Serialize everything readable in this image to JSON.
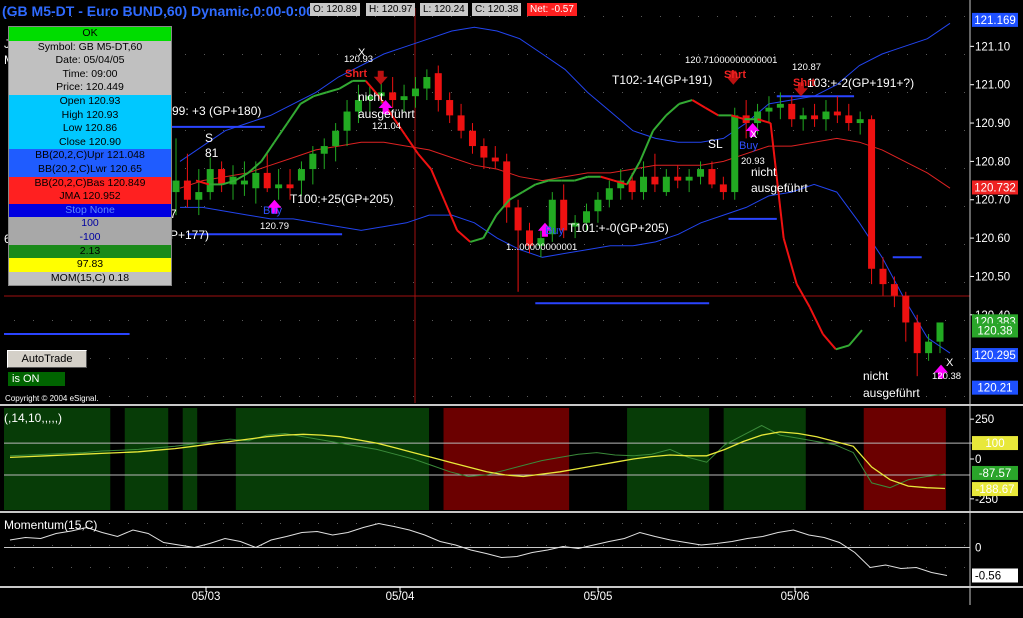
{
  "window": {
    "title": "(GB M5-DT - Euro BUND,60) Dynamic,0:00-0:00",
    "open_label": "O: 120.89",
    "high_label": "H: 120.97",
    "low_label": "L: 120.24",
    "close_label": "C: 120.38",
    "net_label": "Net: -0.57",
    "copyright": "Copyright © 2004 eSignal."
  },
  "colors": {
    "bull_candle": "#22aa22",
    "bear_candle": "#ee1111",
    "bb_band": "#2244ee",
    "bb_basis": "#dd2222",
    "jma_up": "#33aa33",
    "jma_down": "#ee1111",
    "osc_bull_zone": "#073c07",
    "osc_bear_zone": "#6b0000",
    "cci_line": "#e8e83a",
    "momentum_line": "#e0e0e0",
    "buy_arrow": "#ff00ff",
    "short_arrow": "#bb1111"
  },
  "data_window": {
    "header": "OK",
    "symbol": "Symbol: GB M5-DT,60",
    "date": "Date: 05/04/05",
    "time": "Time: 09:00",
    "price": "Price: 120.449",
    "open": "Open 120.93",
    "high": "High 120.93",
    "low": "Low 120.86",
    "close": "Close 120.90",
    "bb_upper": "BB(20,2,C)Upr 121.048",
    "bb_lower": "BB(20,2,C)Lwr 120.65",
    "bb_basis": "BB(20,2,C)Bas 120.849",
    "jma": "JMA 120.952",
    "stop": "Stop  None",
    "v1": "100",
    "v2": "-100",
    "v3": "2.13",
    "v4": "97.83",
    "momentum": "MOM(15,C)  0.18"
  },
  "controls": {
    "autotrade_label": "AutoTrade",
    "status_label": "is ON"
  },
  "panes": {
    "price": "",
    "oscillator": "(,14,10,,,,,)",
    "momentum": "Momentum(15,C)"
  },
  "annotations": {
    "t99": "99: +3 (GP+180)",
    "s": "S",
    "s81": "81",
    "sev": "7",
    "p177": "P+177)",
    "six": "6",
    "t100": "T100:+25(GP+205)",
    "t101": "T101:+-0(GP+205)",
    "t102": "T102:-14(GP+191)",
    "t103": "103:+-2(GP+191+?)",
    "sl": "SL",
    "shrt": "Shrt",
    "buy": "Buy",
    "x": "X",
    "nicht": "nicht",
    "ausgefuhrt": "ausgeführt",
    "p12093": "120.93",
    "p12104": "121.04",
    "p12079": "120.79",
    "p12071": "120.71000000000001",
    "p12087": "120.87",
    "p12093b": "20.93",
    "p12061": "1...00000000001",
    "p12038": "120.38",
    "j": "J",
    "m": "M"
  },
  "chart_data": [
    {
      "type": "candlestick",
      "title": "(GB M5-DT - Euro BUND,60) Dynamic,0:00-0:00",
      "x_tick_labels": [
        "05/03",
        "05/04",
        "05/05",
        "05/06"
      ],
      "y_ticks": [
        120.4,
        120.5,
        120.6,
        120.7,
        120.8,
        120.9,
        121.0,
        121.1
      ],
      "ylim": [
        120.17,
        121.2
      ],
      "price_markers": [
        {
          "label": "121.169",
          "value": 121.169,
          "color": "#1e50ff"
        },
        {
          "label": "120.732",
          "value": 120.732,
          "color": "#ee2222"
        },
        {
          "label": "120.383",
          "value": 120.383,
          "color": "#2aa52a"
        },
        {
          "label": "120.38",
          "value": 120.38,
          "color": "#2aa52a"
        },
        {
          "label": "120.295",
          "value": 120.295,
          "color": "#1e50ff"
        },
        {
          "label": "120.21",
          "value": 120.21,
          "color": "#1e50ff"
        }
      ],
      "candles": [
        {
          "o": 120.72,
          "h": 120.86,
          "l": 120.66,
          "c": 120.75
        },
        {
          "o": 120.75,
          "h": 120.82,
          "l": 120.68,
          "c": 120.7
        },
        {
          "o": 120.7,
          "h": 120.78,
          "l": 120.66,
          "c": 120.72
        },
        {
          "o": 120.72,
          "h": 120.81,
          "l": 120.7,
          "c": 120.78
        },
        {
          "o": 120.78,
          "h": 120.8,
          "l": 120.72,
          "c": 120.74
        },
        {
          "o": 120.74,
          "h": 120.79,
          "l": 120.7,
          "c": 120.76
        },
        {
          "o": 120.74,
          "h": 120.8,
          "l": 120.71,
          "c": 120.75
        },
        {
          "o": 120.73,
          "h": 120.8,
          "l": 120.69,
          "c": 120.77
        },
        {
          "o": 120.77,
          "h": 120.82,
          "l": 120.72,
          "c": 120.73
        },
        {
          "o": 120.73,
          "h": 120.78,
          "l": 120.7,
          "c": 120.74
        },
        {
          "o": 120.74,
          "h": 120.78,
          "l": 120.7,
          "c": 120.73
        },
        {
          "o": 120.75,
          "h": 120.8,
          "l": 120.71,
          "c": 120.78
        },
        {
          "o": 120.78,
          "h": 120.84,
          "l": 120.74,
          "c": 120.82
        },
        {
          "o": 120.82,
          "h": 120.86,
          "l": 120.78,
          "c": 120.84
        },
        {
          "o": 120.84,
          "h": 120.9,
          "l": 120.8,
          "c": 120.88
        },
        {
          "o": 120.88,
          "h": 120.96,
          "l": 120.84,
          "c": 120.93
        },
        {
          "o": 120.93,
          "h": 121.0,
          "l": 120.9,
          "c": 120.96
        },
        {
          "o": 120.96,
          "h": 121.0,
          "l": 120.93,
          "c": 120.97
        },
        {
          "o": 120.97,
          "h": 121.01,
          "l": 120.95,
          "c": 120.98
        },
        {
          "o": 120.98,
          "h": 121.02,
          "l": 120.94,
          "c": 120.96
        },
        {
          "o": 120.96,
          "h": 121.0,
          "l": 120.93,
          "c": 120.97
        },
        {
          "o": 120.97,
          "h": 121.02,
          "l": 120.94,
          "c": 120.99
        },
        {
          "o": 120.99,
          "h": 121.04,
          "l": 120.96,
          "c": 121.02
        },
        {
          "o": 121.03,
          "h": 121.05,
          "l": 120.93,
          "c": 120.96
        },
        {
          "o": 120.96,
          "h": 120.98,
          "l": 120.9,
          "c": 120.92
        },
        {
          "o": 120.92,
          "h": 120.95,
          "l": 120.86,
          "c": 120.88
        },
        {
          "o": 120.88,
          "h": 120.9,
          "l": 120.82,
          "c": 120.84
        },
        {
          "o": 120.84,
          "h": 120.86,
          "l": 120.78,
          "c": 120.81
        },
        {
          "o": 120.81,
          "h": 120.84,
          "l": 120.78,
          "c": 120.8
        },
        {
          "o": 120.8,
          "h": 120.82,
          "l": 120.64,
          "c": 120.68
        },
        {
          "o": 120.68,
          "h": 120.7,
          "l": 120.46,
          "c": 120.62
        },
        {
          "o": 120.62,
          "h": 120.64,
          "l": 120.56,
          "c": 120.58
        },
        {
          "o": 120.58,
          "h": 120.62,
          "l": 120.55,
          "c": 120.6
        },
        {
          "o": 120.61,
          "h": 120.72,
          "l": 120.59,
          "c": 120.7
        },
        {
          "o": 120.7,
          "h": 120.74,
          "l": 120.6,
          "c": 120.62
        },
        {
          "o": 120.63,
          "h": 120.66,
          "l": 120.6,
          "c": 120.64
        },
        {
          "o": 120.64,
          "h": 120.69,
          "l": 120.62,
          "c": 120.67
        },
        {
          "o": 120.67,
          "h": 120.72,
          "l": 120.64,
          "c": 120.7
        },
        {
          "o": 120.7,
          "h": 120.75,
          "l": 120.68,
          "c": 120.73
        },
        {
          "o": 120.73,
          "h": 120.78,
          "l": 120.7,
          "c": 120.75
        },
        {
          "o": 120.75,
          "h": 120.77,
          "l": 120.7,
          "c": 120.72
        },
        {
          "o": 120.72,
          "h": 120.8,
          "l": 120.7,
          "c": 120.76
        },
        {
          "o": 120.76,
          "h": 120.82,
          "l": 120.72,
          "c": 120.74
        },
        {
          "o": 120.72,
          "h": 120.78,
          "l": 120.71,
          "c": 120.76
        },
        {
          "o": 120.76,
          "h": 120.79,
          "l": 120.73,
          "c": 120.75
        },
        {
          "o": 120.75,
          "h": 120.78,
          "l": 120.72,
          "c": 120.76
        },
        {
          "o": 120.76,
          "h": 120.8,
          "l": 120.74,
          "c": 120.78
        },
        {
          "o": 120.78,
          "h": 120.8,
          "l": 120.73,
          "c": 120.74
        },
        {
          "o": 120.74,
          "h": 120.76,
          "l": 120.7,
          "c": 120.72
        },
        {
          "o": 120.72,
          "h": 120.94,
          "l": 120.7,
          "c": 120.92
        },
        {
          "o": 120.92,
          "h": 120.96,
          "l": 120.86,
          "c": 120.9
        },
        {
          "o": 120.9,
          "h": 120.95,
          "l": 120.87,
          "c": 120.93
        },
        {
          "o": 120.93,
          "h": 120.97,
          "l": 120.9,
          "c": 120.94
        },
        {
          "o": 120.94,
          "h": 120.98,
          "l": 120.91,
          "c": 120.95
        },
        {
          "o": 120.95,
          "h": 120.97,
          "l": 120.89,
          "c": 120.91
        },
        {
          "o": 120.91,
          "h": 120.94,
          "l": 120.88,
          "c": 120.92
        },
        {
          "o": 120.92,
          "h": 120.95,
          "l": 120.89,
          "c": 120.91
        },
        {
          "o": 120.91,
          "h": 120.96,
          "l": 120.88,
          "c": 120.93
        },
        {
          "o": 120.93,
          "h": 120.97,
          "l": 120.9,
          "c": 120.92
        },
        {
          "o": 120.92,
          "h": 120.95,
          "l": 120.88,
          "c": 120.9
        },
        {
          "o": 120.9,
          "h": 120.93,
          "l": 120.87,
          "c": 120.91
        },
        {
          "o": 120.91,
          "h": 120.92,
          "l": 120.48,
          "c": 120.52
        },
        {
          "o": 120.52,
          "h": 120.55,
          "l": 120.45,
          "c": 120.48
        },
        {
          "o": 120.48,
          "h": 120.5,
          "l": 120.42,
          "c": 120.45
        },
        {
          "o": 120.45,
          "h": 120.46,
          "l": 120.33,
          "c": 120.38
        },
        {
          "o": 120.38,
          "h": 120.4,
          "l": 120.24,
          "c": 120.3
        },
        {
          "o": 120.3,
          "h": 120.35,
          "l": 120.28,
          "c": 120.33
        },
        {
          "o": 120.33,
          "h": 120.36,
          "l": 120.3,
          "c": 120.38
        }
      ],
      "bb_upper": [
        120.8,
        120.84,
        120.88,
        120.9,
        120.92,
        120.95,
        120.98,
        121.02,
        121.05,
        121.08,
        121.1,
        121.12,
        121.14,
        121.15,
        121.14,
        121.12,
        121.08,
        121.04,
        120.98,
        120.93,
        120.88,
        120.86,
        120.85,
        120.85,
        120.86,
        120.9,
        120.95,
        120.96,
        120.97,
        121.0,
        121.05,
        121.08,
        121.1,
        121.12,
        121.16
      ],
      "bb_lower": [
        120.68,
        120.68,
        120.67,
        120.66,
        120.65,
        120.65,
        120.64,
        120.63,
        120.62,
        120.63,
        120.64,
        120.66,
        120.66,
        120.64,
        120.6,
        120.57,
        120.55,
        120.56,
        120.57,
        120.58,
        120.58,
        120.59,
        120.61,
        120.64,
        120.66,
        120.68,
        120.71,
        120.72,
        120.74,
        120.72,
        120.64,
        120.55,
        120.44,
        120.34,
        120.3
      ],
      "bb_basis": [
        120.73,
        120.75,
        120.76,
        120.77,
        120.79,
        120.81,
        120.83,
        120.84,
        120.85,
        120.85,
        120.84,
        120.83,
        120.81,
        120.79,
        120.78,
        120.76,
        120.75,
        120.76,
        120.77,
        120.77,
        120.78,
        120.79,
        120.79,
        120.79,
        120.8,
        120.82,
        120.84,
        120.84,
        120.85,
        120.86,
        120.85,
        120.83,
        120.8,
        120.77,
        120.73
      ],
      "jma": [
        120.75,
        120.74,
        120.74,
        120.75,
        120.77,
        120.8,
        120.85,
        120.9,
        120.95,
        120.97,
        120.98,
        120.99,
        121.01,
        121.01,
        120.97,
        120.92,
        120.87,
        120.82,
        120.78,
        120.7,
        120.62,
        120.59,
        120.6,
        120.66,
        120.7,
        120.72,
        120.74,
        120.75,
        120.75,
        120.75,
        120.76,
        120.76,
        120.75,
        120.74,
        120.8,
        120.88,
        120.92,
        120.95,
        120.96,
        120.94,
        120.92,
        120.92,
        120.91,
        120.91,
        120.9,
        120.6,
        120.48,
        120.42,
        120.35,
        120.31,
        120.32,
        120.36
      ],
      "horizontal_levels": [
        {
          "value": 120.89,
          "from": 0.14,
          "to": 0.27
        },
        {
          "value": 120.61,
          "from": 0.19,
          "to": 0.35
        },
        {
          "value": 120.43,
          "from": 0.55,
          "to": 0.73
        },
        {
          "value": 120.65,
          "from": 0.75,
          "to": 0.8
        },
        {
          "value": 120.97,
          "from": 0.8,
          "to": 0.88
        },
        {
          "value": 120.35,
          "from": 0.0,
          "to": 0.13
        },
        {
          "value": 120.55,
          "from": 0.92,
          "to": 0.95
        }
      ],
      "current_level": 120.449,
      "signals": [
        {
          "type": "short",
          "x_frac": 0.39,
          "value": 121.0
        },
        {
          "type": "buy",
          "x_frac": 0.28,
          "value": 120.7
        },
        {
          "type": "buy",
          "x_frac": 0.56,
          "value": 120.64
        },
        {
          "type": "short",
          "x_frac": 0.755,
          "value": 121.0
        },
        {
          "type": "short",
          "x_frac": 0.825,
          "value": 120.97
        },
        {
          "type": "buy",
          "x_frac": 0.775,
          "value": 120.9
        },
        {
          "type": "buy",
          "x_frac": 0.395,
          "value": 120.96
        },
        {
          "type": "buy",
          "x_frac": 0.97,
          "value": 120.27
        }
      ]
    },
    {
      "type": "area",
      "title": "(,14,10,,,,,)",
      "y_ticks": [
        250,
        100,
        0,
        -250
      ],
      "ylim": [
        -320,
        320
      ],
      "reference_lines": [
        100,
        -100
      ],
      "price_markers": [
        {
          "label": "100",
          "value": 100,
          "color": "#e8e83a"
        },
        {
          "label": "-87.57",
          "value": -87.57,
          "color": "#2aa52a"
        },
        {
          "label": "-188.67",
          "value": -188.67,
          "color": "#e8e83a"
        }
      ],
      "zones": [
        {
          "from": 0.0,
          "to": 0.11,
          "kind": "bull"
        },
        {
          "from": 0.125,
          "to": 0.17,
          "kind": "bull"
        },
        {
          "from": 0.185,
          "to": 0.2,
          "kind": "bull"
        },
        {
          "from": 0.24,
          "to": 0.44,
          "kind": "bull"
        },
        {
          "from": 0.455,
          "to": 0.585,
          "kind": "bear"
        },
        {
          "from": 0.645,
          "to": 0.73,
          "kind": "bull"
        },
        {
          "from": 0.745,
          "to": 0.83,
          "kind": "bull"
        },
        {
          "from": 0.89,
          "to": 0.975,
          "kind": "bear"
        }
      ],
      "cci": [
        20,
        25,
        30,
        35,
        40,
        50,
        55,
        60,
        70,
        80,
        95,
        110,
        125,
        115,
        150,
        160,
        140,
        120,
        100,
        80,
        60,
        30,
        0,
        -40,
        -80,
        -110,
        -100,
        -70,
        -40,
        -10,
        10,
        30,
        40,
        25,
        20,
        30,
        60,
        10,
        -20,
        90,
        150,
        210,
        150,
        130,
        110,
        90,
        40,
        -150,
        -180,
        -130,
        -110,
        -95
      ],
      "signal": [
        10,
        15,
        20,
        25,
        30,
        35,
        40,
        45,
        55,
        65,
        80,
        95,
        110,
        125,
        140,
        150,
        155,
        150,
        140,
        120,
        100,
        70,
        40,
        10,
        -20,
        -50,
        -80,
        -100,
        -110,
        -95,
        -80,
        -60,
        -40,
        -20,
        0,
        15,
        25,
        20,
        20,
        60,
        110,
        150,
        170,
        160,
        140,
        110,
        80,
        -50,
        -130,
        -170,
        -180,
        -185
      ]
    },
    {
      "type": "line",
      "title": "Momentum(15,C)",
      "y_ticks": [
        0
      ],
      "ylim": [
        -0.75,
        0.65
      ],
      "price_markers": [
        {
          "label": "-0.56",
          "value": -0.56,
          "color": "#ffffff"
        }
      ],
      "values": [
        0.15,
        0.2,
        0.18,
        0.28,
        0.33,
        0.4,
        0.3,
        0.22,
        0.35,
        0.28,
        0.1,
        0.05,
        0.0,
        0.08,
        0.18,
        0.12,
        0.0,
        0.15,
        0.22,
        0.3,
        0.32,
        0.25,
        0.3,
        0.4,
        0.48,
        0.42,
        0.35,
        0.25,
        0.12,
        0.05,
        -0.05,
        -0.12,
        -0.2,
        -0.18,
        -0.1,
        -0.05,
        0.02,
        -0.02,
        0.05,
        0.12,
        0.18,
        0.3,
        0.22,
        0.15,
        0.1,
        0.05,
        0.08,
        0.12,
        0.18,
        0.22,
        0.3,
        0.35,
        0.25,
        0.2,
        0.1,
        -0.1,
        -0.4,
        -0.35,
        -0.42,
        -0.4,
        -0.5,
        -0.56
      ]
    }
  ]
}
